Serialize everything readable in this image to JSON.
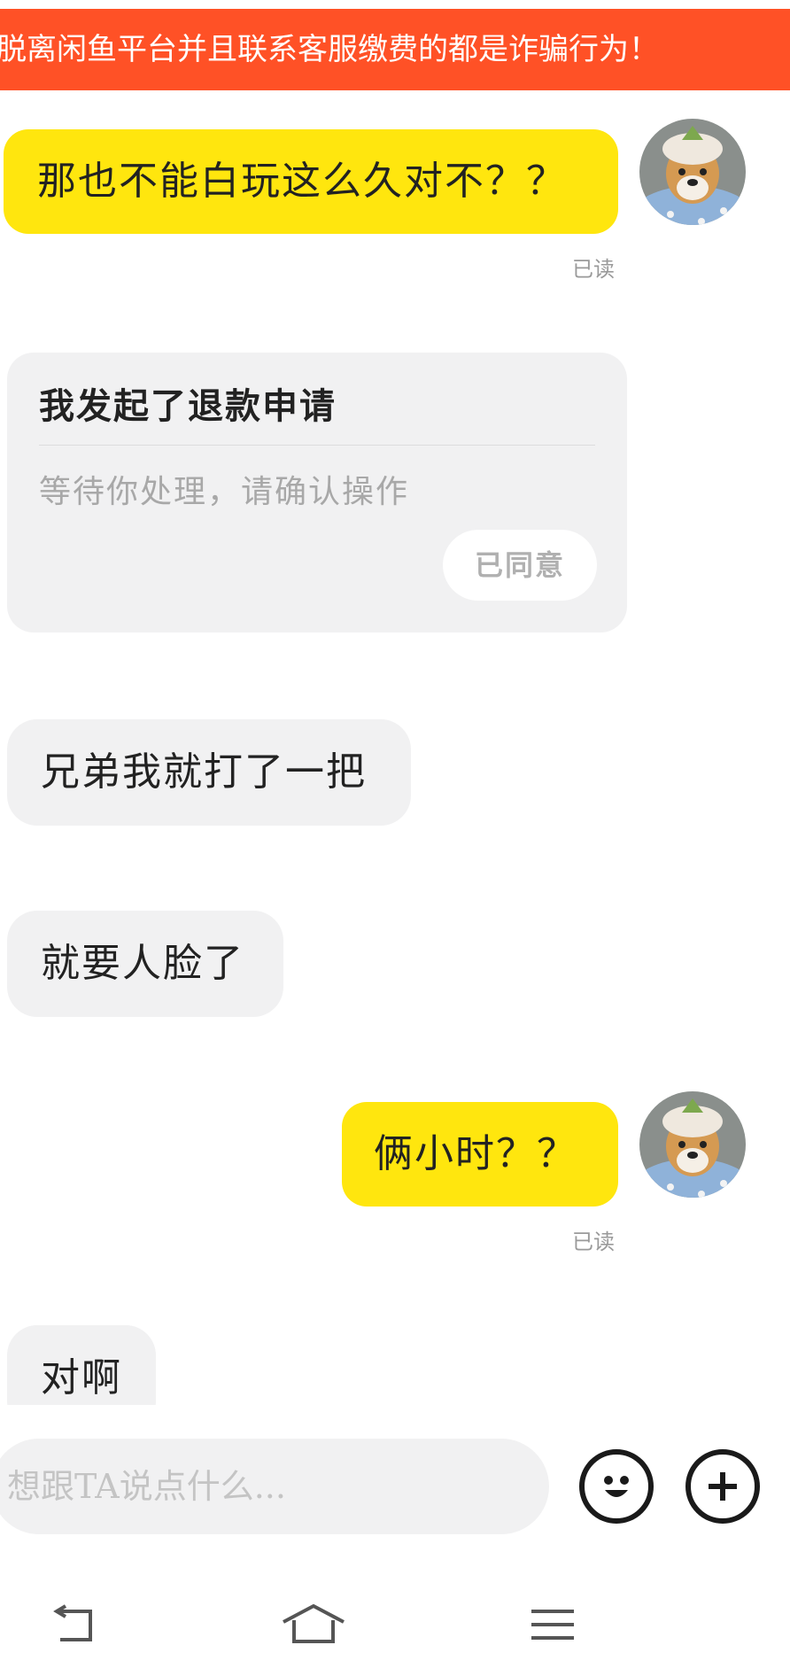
{
  "warning": {
    "text": "脱离闲鱼平台并且联系客服缴费的都是诈骗行为！"
  },
  "messages": [
    {
      "text": "那也不能白玩这么久对不？？",
      "read": "已读"
    },
    {
      "text": "兄弟我就打了一把"
    },
    {
      "text": "就要人脸了"
    },
    {
      "text": "俩小时？？",
      "read": "已读"
    },
    {
      "text": "对啊"
    }
  ],
  "refund_card": {
    "title": "我发起了退款申请",
    "description": "等待你处理，请确认操作",
    "button": "已同意"
  },
  "composer": {
    "placeholder": "想跟TA说点什么...",
    "emoji_icon": "smile-face-icon",
    "plus_icon": "plus-circle-icon"
  },
  "navigation": {
    "back_icon": "back-arrow-icon",
    "home_icon": "home-icon",
    "menu_icon": "menu-lines-icon"
  },
  "colors": {
    "warning_bg": "#ff5126",
    "self_bubble": "#ffe60e",
    "other_bubble": "#f1f1f2"
  }
}
